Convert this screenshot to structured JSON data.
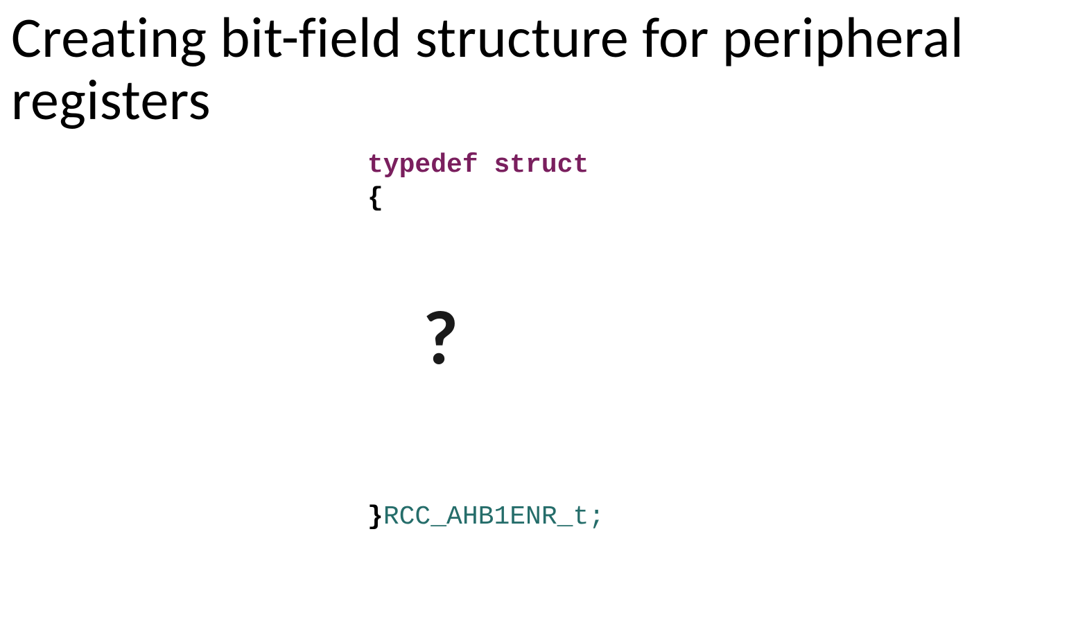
{
  "title": "Creating bit-field structure for peripheral registers",
  "code": {
    "line1_part1": "typedef",
    "line1_space": " ",
    "line1_part2": "struct",
    "line2": "{",
    "end_brace": "}",
    "typename": "RCC_AHB1ENR_t;",
    "placeholder": "?"
  }
}
